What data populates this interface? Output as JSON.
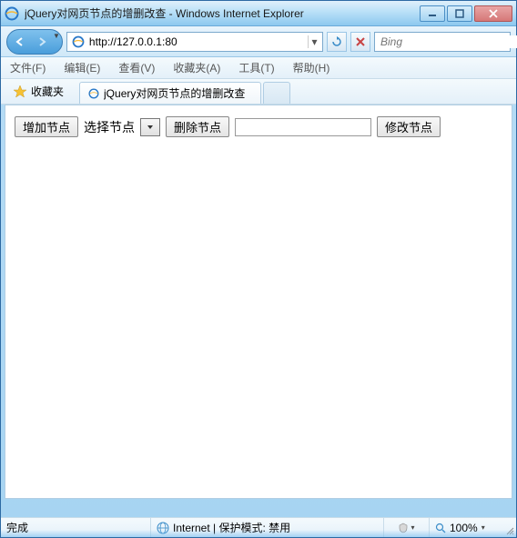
{
  "window": {
    "title": "jQuery对网页节点的增删改查 - Windows Internet Explorer"
  },
  "nav": {
    "url": "http://127.0.0.1:80",
    "search_placeholder": "Bing"
  },
  "menu": {
    "file": "文件(F)",
    "edit": "编辑(E)",
    "view": "查看(V)",
    "favorites": "收藏夹(A)",
    "tools": "工具(T)",
    "help": "帮助(H)"
  },
  "favbar": {
    "favorites_label": "收藏夹"
  },
  "tab": {
    "title": "jQuery对网页节点的增删改查"
  },
  "page": {
    "add_btn": "增加节点",
    "select_label": "选择节点",
    "delete_btn": "删除节点",
    "modify_btn": "修改节点",
    "input_value": ""
  },
  "status": {
    "left": "完成",
    "zone": "Internet | 保护模式: 禁用",
    "zoom": "100%"
  }
}
